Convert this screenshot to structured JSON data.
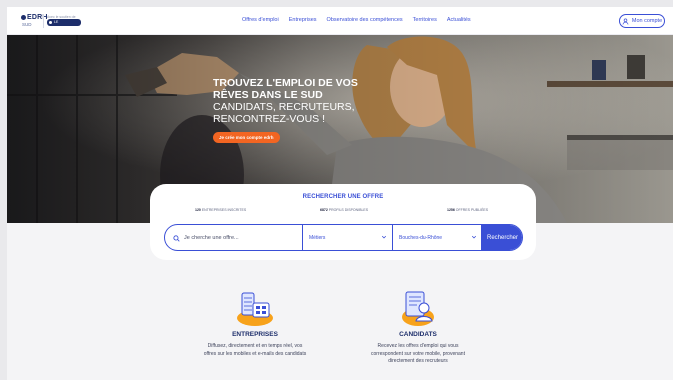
{
  "brand": {
    "logo_name": "EDRH",
    "logo_sub": "SUD",
    "partner_caption": "Avec le soutien de",
    "partner_label": "LE DÉPARTEMENT"
  },
  "nav": {
    "items": [
      {
        "label": "Offres d'emploi"
      },
      {
        "label": "Entreprises"
      },
      {
        "label": "Observatoire des compétences"
      },
      {
        "label": "Territoires"
      },
      {
        "label": "Actualités"
      }
    ],
    "account_label": "Mon compte"
  },
  "hero": {
    "title_line1": "TROUVEZ L'EMPLOI DE VOS",
    "title_line2": "RÊVES DANS LE SUD",
    "subtitle_line1": "CANDIDATS, RECRUTEURS,",
    "subtitle_line2": "RENCONTREZ-VOUS !",
    "cta_label": "Je crée mon compte edrh"
  },
  "search": {
    "title": "RECHERCHER UNE OFFRE",
    "stats": [
      {
        "count": "120",
        "label": "ENTREPRISES INSCRITES"
      },
      {
        "count": "6872",
        "label": "PROFILS DISPONIBLES"
      },
      {
        "count": "1256",
        "label": "OFFRES PUBLIÉES"
      }
    ],
    "query_placeholder": "Je cherche une offre...",
    "job_select": "Métiers",
    "location_select": "Bouches-du-Rhône",
    "submit_label": "Rechercher"
  },
  "features": [
    {
      "title": "ENTREPRISES",
      "desc_line1": "Diffusez, directement et en temps réel, vos",
      "desc_line2": "offres sur les mobiles et e-mails des candidats",
      "desc_line3": ""
    },
    {
      "title": "CANDIDATS",
      "desc_line1": "Recevez les offres d'emploi qui vous",
      "desc_line2": "correspondent sur votre mobile, provenant",
      "desc_line3": "directement des recruteurs"
    }
  ],
  "colors": {
    "accent": "#3a4fd6",
    "brand_dark": "#1d2e6b",
    "cta": "#f26522",
    "page_bg": "#f4f4f6"
  }
}
